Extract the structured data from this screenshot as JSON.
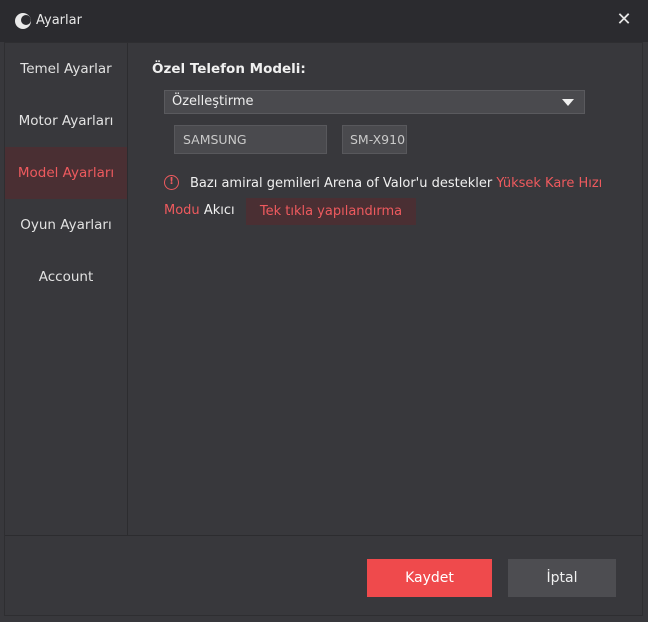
{
  "window": {
    "title": "Ayarlar"
  },
  "sidebar": {
    "items": [
      {
        "label": "Temel Ayarlar"
      },
      {
        "label": "Motor Ayarları"
      },
      {
        "label": "Model Ayarları",
        "active": true
      },
      {
        "label": "Oyun Ayarları"
      },
      {
        "label": "Account"
      }
    ]
  },
  "model_settings": {
    "title": "Özel Telefon Modeli:",
    "dropdown_value": "Özelleştirme",
    "brand_value": "SAMSUNG",
    "model_value": "SM-X910",
    "notice_text": "Bazı amiral gemileri Arena of Valor'u destekler",
    "notice_highlight_1": "Yüksek Kare Hızı",
    "notice_highlight_2": "Modu",
    "notice_suffix": "Akıcı",
    "config_button": "Tek tıkla yapılandırma"
  },
  "footer": {
    "save_label": "Kaydet",
    "cancel_label": "İptal"
  },
  "colors": {
    "accent": "#ef4a4c",
    "active_bg": "#4a2f33",
    "panel": "#38383c"
  },
  "icons": {
    "close": "close-icon",
    "warning": "warning-icon",
    "logo": "app-logo-icon",
    "dropdown": "chevron-down-icon"
  }
}
